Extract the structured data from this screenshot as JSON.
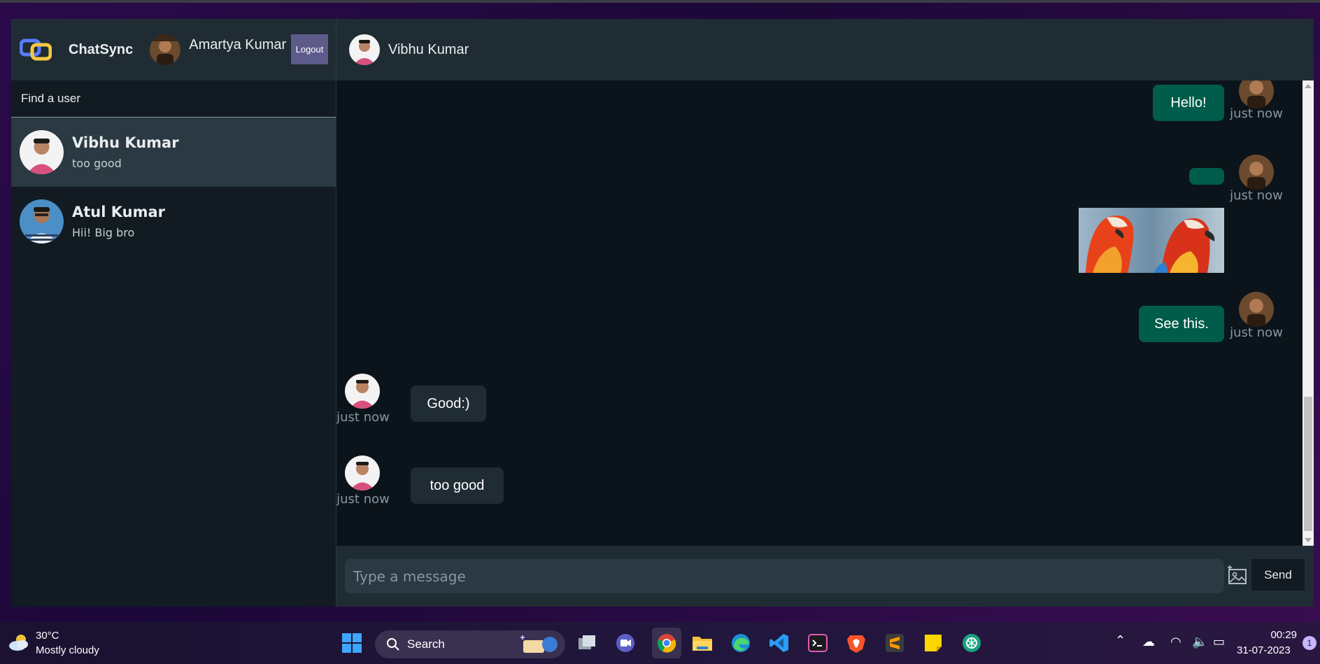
{
  "app": {
    "brand": "ChatSync",
    "current_user": "Amartya Kumar",
    "logout_label": "Logout"
  },
  "sidebar": {
    "search_placeholder": "Find a user",
    "users": [
      {
        "name": "Vibhu Kumar",
        "last_message": "too good"
      },
      {
        "name": "Atul Kumar",
        "last_message": "Hii! Big bro"
      }
    ]
  },
  "chat": {
    "contact_name": "Vibhu Kumar",
    "messages": [
      {
        "direction": "out",
        "text": "Hello!",
        "time": "just now"
      },
      {
        "direction": "out",
        "text": "",
        "time": "just now",
        "has_image": true
      },
      {
        "direction": "out",
        "text": "See this.",
        "time": "just now"
      },
      {
        "direction": "in",
        "text": "Good:)",
        "time": "just now"
      },
      {
        "direction": "in",
        "text": "too good",
        "time": "just now"
      }
    ],
    "input_placeholder": "Type a message",
    "send_label": "Send"
  },
  "taskbar": {
    "weather_temp": "30°C",
    "weather_desc": "Mostly cloudy",
    "search_label": "Search",
    "time": "00:29",
    "date": "31-07-2023",
    "notifications": "1"
  },
  "colors": {
    "outgoing_bubble": "#005c4b",
    "incoming_bubble": "#202c33",
    "header": "#202c33",
    "chat_bg": "#0b141a",
    "logout_button": "#5c5b8a"
  }
}
